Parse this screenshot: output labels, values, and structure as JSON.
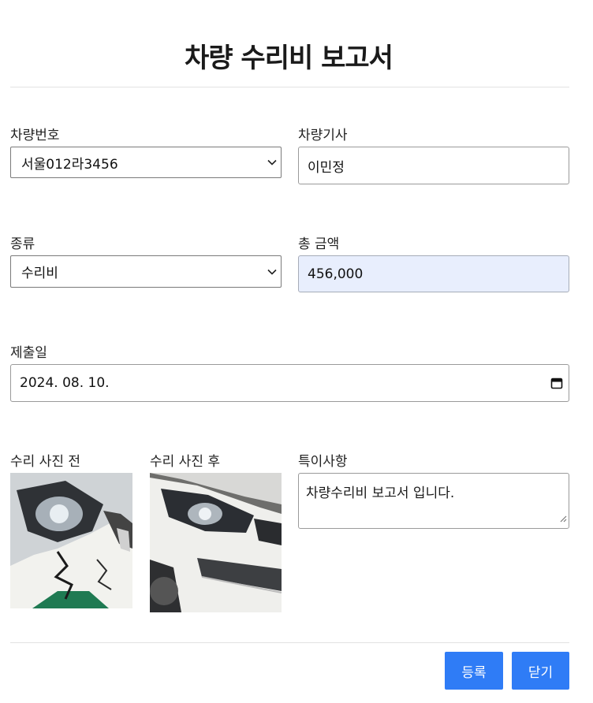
{
  "header": {
    "title": "차량 수리비 보고서"
  },
  "form": {
    "vehicle_number": {
      "label": "차량번호",
      "value": "서울012라3456"
    },
    "driver": {
      "label": "차량기사",
      "value": "이민정"
    },
    "category": {
      "label": "종류",
      "value": "수리비"
    },
    "total_amount": {
      "label": "총 금액",
      "value": "456,000"
    },
    "submit_date": {
      "label": "제출일",
      "value": "2024. 08. 10."
    },
    "photo_before": {
      "label": "수리 사진 전"
    },
    "photo_after": {
      "label": "수리 사진 후"
    },
    "notes": {
      "label": "특이사항",
      "value": "차량수리비 보고서 입니다."
    }
  },
  "actions": {
    "register_label": "등록",
    "close_label": "닫기"
  },
  "icons": {
    "select_arrow": "chevron-down-icon",
    "date_picker": "calendar-icon",
    "resize_handle": "resize-grip-icon"
  },
  "colors": {
    "primary": "#2f7cf6",
    "readonly_bg": "#e8eefd"
  }
}
